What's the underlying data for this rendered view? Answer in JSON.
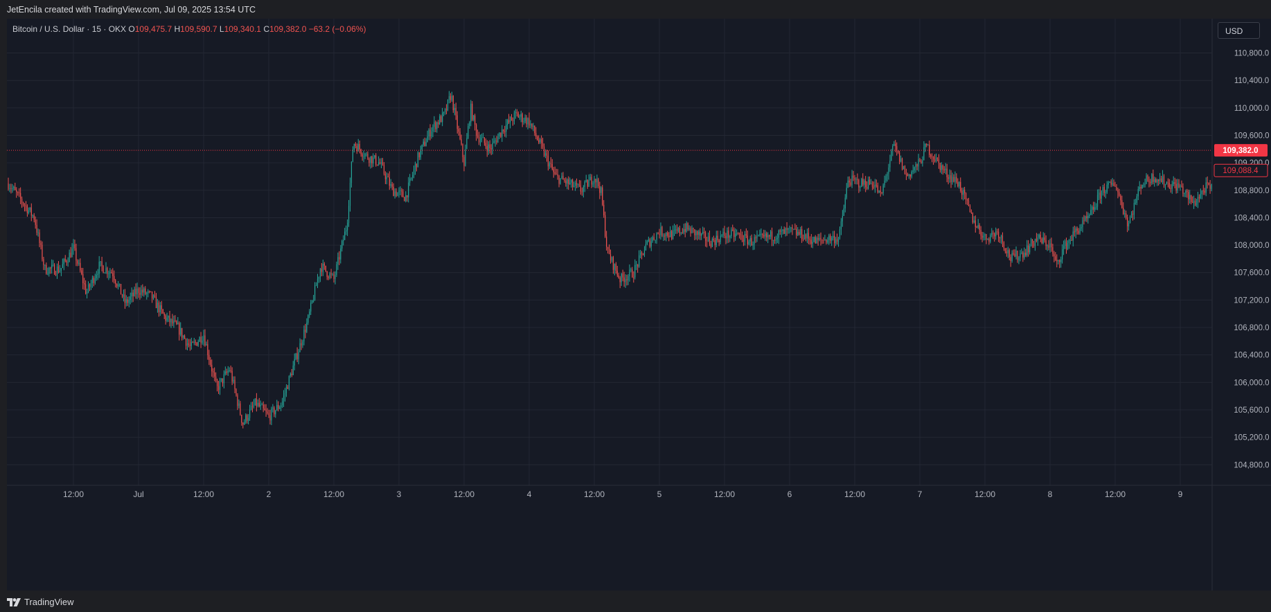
{
  "header": {
    "attribution": "JetEncila created with TradingView.com, Jul 09, 2025 13:54 UTC"
  },
  "legend": {
    "symbol": "Bitcoin / U.S. Dollar · 15 · OKX",
    "open_label": "O",
    "open": "109,475.7",
    "high_label": "H",
    "high": "109,590.7",
    "low_label": "L",
    "low": "109,340.1",
    "close_label": "C",
    "close": "109,382.0",
    "change": "−63.2 (−0.06%)"
  },
  "currency_button": "USD",
  "footer": {
    "brand": "TradingView"
  },
  "colors": {
    "background": "#161a25",
    "grid": "#232733",
    "up": "#26a69a",
    "down": "#ef5350",
    "axis_text": "#b2b5be",
    "price_line": "#f23645"
  },
  "chart_data": {
    "type": "candlestick",
    "symbol": "BTCUSD",
    "interval": "15",
    "exchange": "OKX",
    "ylim": [
      104500,
      111300
    ],
    "y_ticks": [
      104800,
      105200,
      105600,
      106000,
      106400,
      106800,
      107200,
      107600,
      108000,
      108400,
      108800,
      109200,
      109600,
      110000,
      110400,
      110800
    ],
    "y_tick_labels": [
      "104,800.0",
      "105,200.0",
      "105,600.0",
      "106,000.0",
      "106,400.0",
      "106,800.0",
      "107,200.0",
      "107,600.0",
      "108,000.0",
      "108,400.0",
      "108,800.0",
      "109,200.0",
      "109,600.0",
      "110,000.0",
      "110,400.0",
      "110,800.0"
    ],
    "x_range": [
      0,
      8.8
    ],
    "x_ticks": [
      {
        "day": 0.5,
        "label": "12:00"
      },
      {
        "day": 1.0,
        "label": "Jul"
      },
      {
        "day": 1.5,
        "label": "12:00"
      },
      {
        "day": 2.0,
        "label": "2"
      },
      {
        "day": 2.5,
        "label": "12:00"
      },
      {
        "day": 3.0,
        "label": "3"
      },
      {
        "day": 3.5,
        "label": "12:00"
      },
      {
        "day": 4.0,
        "label": "4"
      },
      {
        "day": 4.5,
        "label": "12:00"
      },
      {
        "day": 5.0,
        "label": "5"
      },
      {
        "day": 5.5,
        "label": "12:00"
      },
      {
        "day": 6.0,
        "label": "6"
      },
      {
        "day": 6.5,
        "label": "12:00"
      },
      {
        "day": 7.0,
        "label": "7"
      },
      {
        "day": 7.5,
        "label": "12:00"
      },
      {
        "day": 8.0,
        "label": "8"
      },
      {
        "day": 8.5,
        "label": "12:00"
      },
      {
        "day": 9.0,
        "label": "9"
      }
    ],
    "price_path": [
      [
        0.0,
        108900
      ],
      [
        0.1,
        108650
      ],
      [
        0.2,
        108400
      ],
      [
        0.28,
        107650
      ],
      [
        0.4,
        107650
      ],
      [
        0.5,
        107950
      ],
      [
        0.6,
        107300
      ],
      [
        0.7,
        107700
      ],
      [
        0.8,
        107600
      ],
      [
        0.9,
        107150
      ],
      [
        1.0,
        107350
      ],
      [
        1.1,
        107250
      ],
      [
        1.2,
        106950
      ],
      [
        1.3,
        106800
      ],
      [
        1.4,
        106500
      ],
      [
        1.5,
        106700
      ],
      [
        1.6,
        105900
      ],
      [
        1.7,
        106200
      ],
      [
        1.8,
        105400
      ],
      [
        1.9,
        105700
      ],
      [
        2.0,
        105500
      ],
      [
        2.1,
        105700
      ],
      [
        2.2,
        106300
      ],
      [
        2.3,
        106900
      ],
      [
        2.4,
        107700
      ],
      [
        2.5,
        107500
      ],
      [
        2.6,
        108300
      ],
      [
        2.65,
        109500
      ],
      [
        2.75,
        109300
      ],
      [
        2.85,
        109200
      ],
      [
        2.95,
        108800
      ],
      [
        3.05,
        108700
      ],
      [
        3.15,
        109300
      ],
      [
        3.25,
        109700
      ],
      [
        3.35,
        109900
      ],
      [
        3.4,
        110200
      ],
      [
        3.5,
        109200
      ],
      [
        3.55,
        110000
      ],
      [
        3.6,
        109600
      ],
      [
        3.7,
        109400
      ],
      [
        3.8,
        109700
      ],
      [
        3.9,
        109900
      ],
      [
        4.0,
        109800
      ],
      [
        4.1,
        109400
      ],
      [
        4.2,
        109000
      ],
      [
        4.3,
        108900
      ],
      [
        4.4,
        108800
      ],
      [
        4.5,
        109000
      ],
      [
        4.55,
        108800
      ],
      [
        4.6,
        107900
      ],
      [
        4.7,
        107500
      ],
      [
        4.8,
        107600
      ],
      [
        4.9,
        108000
      ],
      [
        5.0,
        108200
      ],
      [
        5.1,
        108150
      ],
      [
        5.2,
        108250
      ],
      [
        5.3,
        108150
      ],
      [
        5.4,
        108050
      ],
      [
        5.5,
        108150
      ],
      [
        5.6,
        108150
      ],
      [
        5.7,
        108050
      ],
      [
        5.8,
        108100
      ],
      [
        5.9,
        108150
      ],
      [
        6.0,
        108200
      ],
      [
        6.1,
        108150
      ],
      [
        6.2,
        108050
      ],
      [
        6.3,
        108100
      ],
      [
        6.38,
        108100
      ],
      [
        6.45,
        108950
      ],
      [
        6.55,
        108900
      ],
      [
        6.65,
        108900
      ],
      [
        6.7,
        108700
      ],
      [
        6.8,
        109450
      ],
      [
        6.9,
        109000
      ],
      [
        7.0,
        109200
      ],
      [
        7.05,
        109450
      ],
      [
        7.1,
        109300
      ],
      [
        7.2,
        109050
      ],
      [
        7.3,
        108900
      ],
      [
        7.4,
        108400
      ],
      [
        7.5,
        108100
      ],
      [
        7.6,
        108200
      ],
      [
        7.7,
        107800
      ],
      [
        7.8,
        107900
      ],
      [
        7.9,
        108100
      ],
      [
        8.0,
        108000
      ],
      [
        8.05,
        107700
      ],
      [
        8.1,
        107950
      ],
      [
        8.2,
        108200
      ],
      [
        8.3,
        108400
      ],
      [
        8.4,
        108800
      ],
      [
        8.5,
        108900
      ],
      [
        8.6,
        108300
      ],
      [
        8.7,
        108900
      ],
      [
        8.8,
        109000
      ],
      [
        8.9,
        108900
      ],
      [
        9.0,
        108850
      ],
      [
        9.1,
        108600
      ],
      [
        9.2,
        108850
      ],
      [
        9.3,
        108750
      ],
      [
        9.4,
        108900
      ],
      [
        9.5,
        109200
      ]
    ],
    "last_price": 109382.0,
    "last_price_label": "109,382.0",
    "secondary_price": 109088.4,
    "secondary_price_label": "109,088.4",
    "grid": true
  }
}
